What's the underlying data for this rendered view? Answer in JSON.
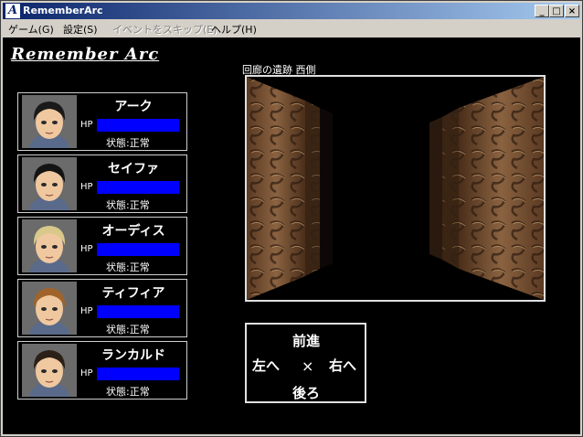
{
  "window": {
    "title": "RememberArc",
    "icon": "A",
    "controls": {
      "minimize": "_",
      "maximize": "□",
      "close": "×"
    }
  },
  "menu": [
    {
      "label": "ゲーム(G)",
      "enabled": true
    },
    {
      "label": "設定(S)",
      "enabled": true
    },
    {
      "label": "イベントをスキップ(E)",
      "enabled": false
    },
    {
      "label": "ヘルプ(H)",
      "enabled": true
    }
  ],
  "game": {
    "title": "Remember Arc",
    "location": "回廊の遺跡 西側"
  },
  "party": [
    {
      "name": "アーク",
      "hp_label": "HP",
      "hp_fraction": 1.0,
      "status": "状態:正常",
      "hair": "#1a1a1a"
    },
    {
      "name": "セイファ",
      "hp_label": "HP",
      "hp_fraction": 1.0,
      "status": "状態:正常",
      "hair": "#141414"
    },
    {
      "name": "オーディス",
      "hp_label": "HP",
      "hp_fraction": 1.0,
      "status": "状態:正常",
      "hair": "#d8c98a"
    },
    {
      "name": "ティフィア",
      "hp_label": "HP",
      "hp_fraction": 1.0,
      "status": "状態:正常",
      "hair": "#a0642a"
    },
    {
      "name": "ランカルド",
      "hp_label": "HP",
      "hp_fraction": 1.0,
      "status": "状態:正常",
      "hair": "#2a2018"
    }
  ],
  "navigation": {
    "forward": "前進",
    "left": "左へ",
    "center": "×",
    "right": "右へ",
    "back": "後ろ"
  },
  "colors": {
    "hp_bar": "#0000ff",
    "wall": "#7a5536",
    "titlebar_start": "#0a246a",
    "titlebar_end": "#a6caf0"
  }
}
